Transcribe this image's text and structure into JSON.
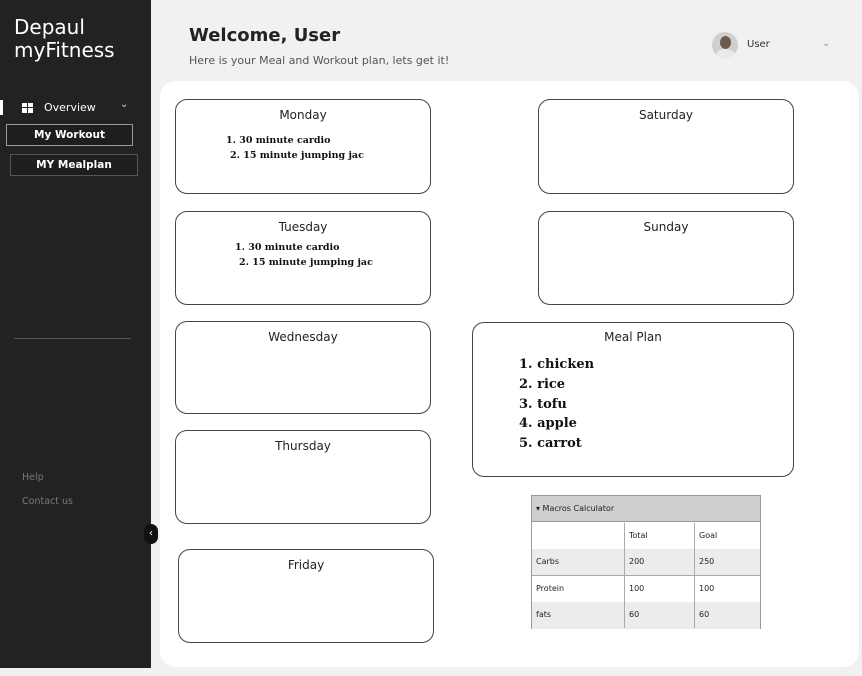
{
  "sidebar": {
    "logo_line1": "Depaul",
    "logo_line2": "myFitness",
    "overview_label": "Overview",
    "overview_icon": "dashboard-grid-icon",
    "workout_label": "My Workout",
    "mealplan_label": "MY Mealplan",
    "help_label": "Help",
    "contact_label": "Contact us"
  },
  "header": {
    "title": "Welcome, User",
    "subtitle": "Here is your Meal and Workout plan, lets get it!",
    "user_name": "User"
  },
  "days": {
    "monday": {
      "title": "Monday",
      "items": [
        "1. 30 minute cardio",
        "2. 15 minute jumping jac"
      ]
    },
    "tuesday": {
      "title": "Tuesday",
      "items": [
        "1. 30 minute cardio",
        "2. 15 minute jumping jac"
      ]
    },
    "wednesday": {
      "title": "Wednesday"
    },
    "thursday": {
      "title": "Thursday"
    },
    "friday": {
      "title": "Friday"
    },
    "saturday": {
      "title": "Saturday"
    },
    "sunday": {
      "title": "Sunday"
    }
  },
  "meal_plan": {
    "title": "Meal Plan",
    "items": [
      "1. chicken",
      "2. rice",
      "3. tofu",
      "4. apple",
      "5. carrot"
    ]
  },
  "macros": {
    "title": "▾ Macros Calculator",
    "columns": [
      "",
      "Total",
      "Goal"
    ],
    "rows": [
      [
        "Carbs",
        "200",
        "250"
      ],
      [
        "Protein",
        "100",
        "100"
      ],
      [
        "fats",
        "60",
        "60"
      ]
    ]
  },
  "colors": {
    "sidebar_bg": "#222222",
    "page_bg": "#f1f1f1",
    "card_border": "#444444"
  }
}
